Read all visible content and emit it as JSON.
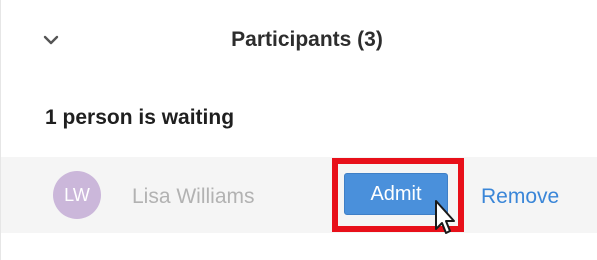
{
  "participants_panel": {
    "title": "Participants (3)",
    "collapse_icon": "chevron-down-icon",
    "waiting_room": {
      "heading": "1 person is waiting",
      "entries": [
        {
          "initials": "LW",
          "name": "Lisa Williams",
          "avatar_color": "#cbb7da",
          "admit_label": "Admit",
          "remove_label": "Remove"
        }
      ]
    }
  },
  "colors": {
    "admit_button": "#4a90db",
    "remove_link": "#3a86d8",
    "highlight_box": "#e8101a"
  },
  "cursor_icon": "mouse-pointer-icon"
}
